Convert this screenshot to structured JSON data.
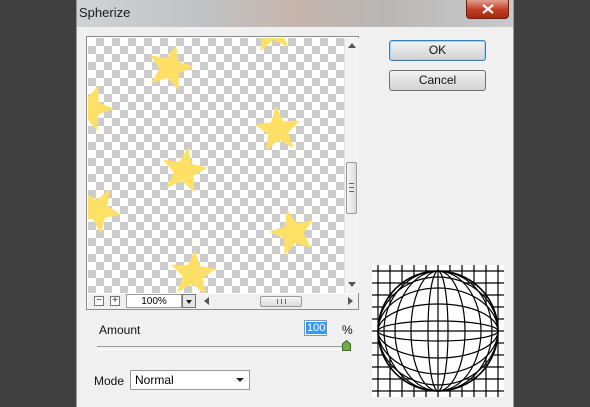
{
  "window": {
    "title": "Spherize",
    "close_icon": "close-icon"
  },
  "buttons": {
    "ok_label": "OK",
    "cancel_label": "Cancel"
  },
  "preview": {
    "zoom_out_label": "−",
    "zoom_in_label": "+",
    "zoom_value": "100%"
  },
  "controls": {
    "amount_label": "Amount",
    "amount_value": "100",
    "amount_unit": "%",
    "amount_slider_percent": 100,
    "mode_label": "Mode",
    "mode_value": "Normal"
  },
  "colors": {
    "star": "#ffe066",
    "close_button": "#c23b22",
    "selection": "#3399ff"
  }
}
